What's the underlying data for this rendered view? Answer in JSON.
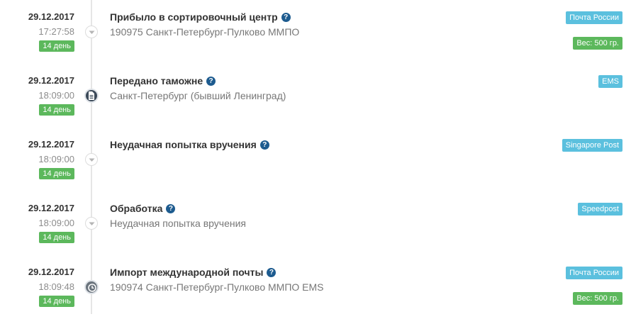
{
  "events": [
    {
      "date": "29.12.2017",
      "time": "17:27:58",
      "day": "14 день",
      "title": "Прибыло в сортировочный центр",
      "location": "190975 Санкт-Петербург-Пулково ММПО",
      "carrier": "Почта России",
      "weight": "Вес: 500 гр.",
      "marker_icon": "chevron-down-icon"
    },
    {
      "date": "29.12.2017",
      "time": "18:09:00",
      "day": "14 день",
      "title": "Передано таможне",
      "location": "Санкт-Петербург (бывший Ленинград)",
      "carrier": "EMS",
      "marker_icon": "document-icon"
    },
    {
      "date": "29.12.2017",
      "time": "18:09:00",
      "day": "14 день",
      "title": "Неудачная попытка вручения",
      "carrier": "Singapore Post",
      "marker_icon": "chevron-down-icon"
    },
    {
      "date": "29.12.2017",
      "time": "18:09:00",
      "day": "14 день",
      "title": "Обработка",
      "location": "Неудачная попытка вручения",
      "carrier": "Speedpost",
      "marker_icon": "chevron-down-icon"
    },
    {
      "date": "29.12.2017",
      "time": "18:09:48",
      "day": "14 день",
      "title": "Импорт международной почты",
      "location": "190974 Санкт-Петербург-Пулково ММПО EMS",
      "carrier": "Почта России",
      "weight": "Вес: 500 гр.",
      "marker_icon": "clock-icon"
    }
  ],
  "help_glyph": "?",
  "colors": {
    "day_badge": "#5cb85c",
    "carrier_badge": "#5bc0de",
    "weight_badge": "#5cb85c",
    "help_icon": "#1d5b8f"
  }
}
